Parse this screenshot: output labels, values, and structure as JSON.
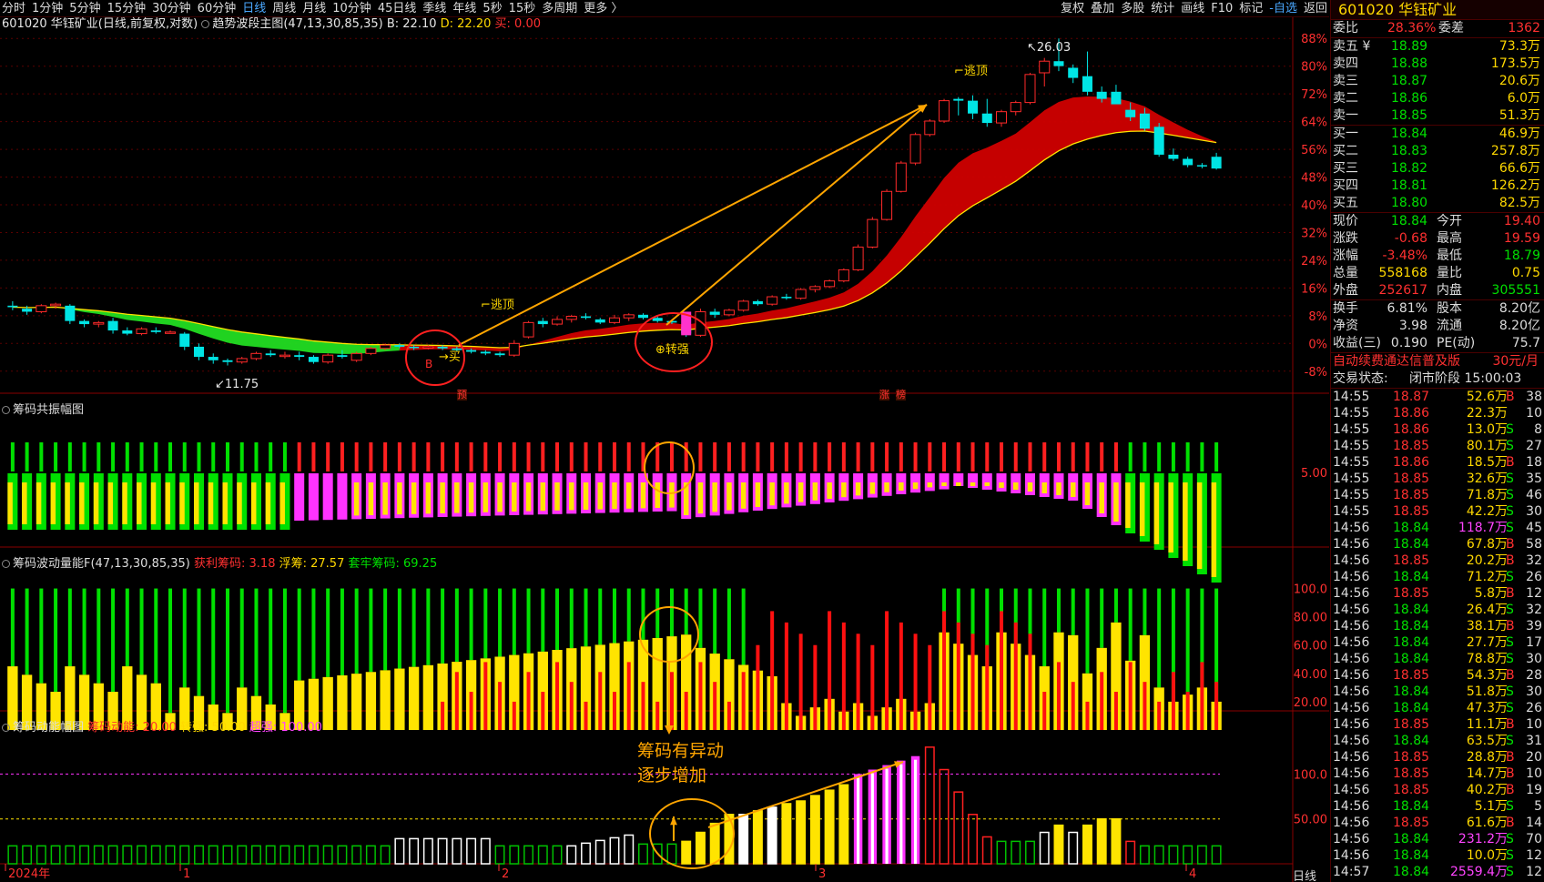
{
  "topbar": {
    "periods": [
      "分时",
      "1分钟",
      "5分钟",
      "15分钟",
      "30分钟",
      "60分钟",
      "日线",
      "周线",
      "月线",
      "10分钟",
      "45日线",
      "季线",
      "年线",
      "5秒",
      "15秒",
      "多周期",
      "更多 〉"
    ],
    "active_period": "日线",
    "tools": [
      "复权",
      "叠加",
      "多股",
      "统计",
      "画线",
      "F10",
      "标记",
      "-自选",
      "返回"
    ]
  },
  "main_panel": {
    "title": "601020 华钰矿业(日线,前复权,对数)",
    "indicator": "趋势波段主图(47,13,30,85,35)",
    "b_value": "B: 22.10",
    "d_value": "D: 22.20",
    "buy_value": "买: 0.00",
    "y_axis": [
      "88%",
      "80%",
      "72%",
      "64%",
      "56%",
      "48%",
      "40%",
      "32%",
      "24%",
      "16%",
      "8%",
      "0%",
      "-8%"
    ],
    "annotations": {
      "high": "26.03",
      "low": "11.75",
      "escape_top": "逃顶",
      "strong": "转强",
      "buy": "买",
      "b_mark": "B",
      "pre": "预",
      "rise": "涨",
      "list": "榜"
    }
  },
  "panel2": {
    "title": "筹码共振幅图",
    "y_axis": [
      "5.00"
    ]
  },
  "panel3": {
    "title": "筹码波动量能F(47,13,30,85,35)",
    "profit_label": "获利筹码: 3.18",
    "float_label": "浮筹: 27.57",
    "locked_label": "套牢筹码: 69.25",
    "y_axis": [
      "100.0",
      "80.00",
      "60.00",
      "40.00",
      "20.00"
    ]
  },
  "panel4": {
    "title": "筹码动能幅图",
    "momentum_label": "筹码动能: 20.00",
    "strong_label": "转强: 50.00",
    "super_label": "超强: 100.00",
    "y_axis": [
      "100.0",
      "50.00"
    ],
    "annotation_line1": "筹码有异动",
    "annotation_line2": "逐步增加"
  },
  "x_axis": {
    "labels": [
      "2024年",
      "1",
      "2",
      "3",
      "4"
    ],
    "period_label": "日线"
  },
  "colors": {
    "up": "#ff2a2a",
    "down": "#00e5e5",
    "bull": "#d00000",
    "bear": "#22dd22",
    "yellow": "#ffe400",
    "magenta": "#ff33ff",
    "annotation": "#ffa500"
  },
  "quote": {
    "code": "601020",
    "name": "华钰矿业",
    "weibi_label": "委比",
    "weibi": "28.36%",
    "weicha_label": "委差",
    "weicha": "1362",
    "sell": [
      {
        "label": "卖五 ¥",
        "price": "18.89",
        "vol": "73.3万"
      },
      {
        "label": "卖四",
        "price": "18.88",
        "vol": "173.5万"
      },
      {
        "label": "卖三",
        "price": "18.87",
        "vol": "20.6万"
      },
      {
        "label": "卖二",
        "price": "18.86",
        "vol": "6.0万"
      },
      {
        "label": "卖一",
        "price": "18.85",
        "vol": "51.3万"
      }
    ],
    "buy": [
      {
        "label": "买一",
        "price": "18.84",
        "vol": "46.9万"
      },
      {
        "label": "买二",
        "price": "18.83",
        "vol": "257.8万"
      },
      {
        "label": "买三",
        "price": "18.82",
        "vol": "66.6万"
      },
      {
        "label": "买四",
        "price": "18.81",
        "vol": "126.2万"
      },
      {
        "label": "买五",
        "price": "18.80",
        "vol": "82.5万"
      }
    ],
    "stats": [
      {
        "l1": "现价",
        "v1": "18.84",
        "l2": "今开",
        "v2": "19.40"
      },
      {
        "l1": "涨跌",
        "v1": "-0.68",
        "l2": "最高",
        "v2": "19.59"
      },
      {
        "l1": "涨幅",
        "v1": "-3.48%",
        "l2": "最低",
        "v2": "18.79"
      },
      {
        "l1": "总量",
        "v1": "558168",
        "l2": "量比",
        "v2": "0.75"
      },
      {
        "l1": "外盘",
        "v1": "252617",
        "l2": "内盘",
        "v2": "305551"
      }
    ],
    "fund": [
      {
        "l1": "换手",
        "v1": "6.81%",
        "l2": "股本",
        "v2": "8.20亿"
      },
      {
        "l1": "净资",
        "v1": "3.98",
        "l2": "流通",
        "v2": "8.20亿"
      },
      {
        "l1": "收益(三)",
        "v1": "0.190",
        "l2": "PE(动)",
        "v2": "75.7"
      }
    ],
    "promo": "自动续费通达信普及版",
    "promo_price": "30元/月",
    "status_label": "交易状态:",
    "status": "闭市阶段 15:00:03"
  },
  "ticks": [
    {
      "t": "14:55",
      "p": "18.87",
      "v": "52.6万",
      "s": "B",
      "n": "38"
    },
    {
      "t": "14:55",
      "p": "18.86",
      "v": "22.3万",
      "s": "",
      "n": "10"
    },
    {
      "t": "14:55",
      "p": "18.86",
      "v": "13.0万",
      "s": "S",
      "n": "8"
    },
    {
      "t": "14:55",
      "p": "18.85",
      "v": "80.1万",
      "s": "S",
      "n": "27"
    },
    {
      "t": "14:55",
      "p": "18.86",
      "v": "18.5万",
      "s": "B",
      "n": "18"
    },
    {
      "t": "14:55",
      "p": "18.85",
      "v": "32.6万",
      "s": "S",
      "n": "35"
    },
    {
      "t": "14:55",
      "p": "18.85",
      "v": "71.8万",
      "s": "S",
      "n": "46"
    },
    {
      "t": "14:55",
      "p": "18.85",
      "v": "42.2万",
      "s": "S",
      "n": "30"
    },
    {
      "t": "14:56",
      "p": "18.84",
      "v": "118.7万",
      "s": "S",
      "n": "45"
    },
    {
      "t": "14:56",
      "p": "18.84",
      "v": "67.8万",
      "s": "B",
      "n": "58"
    },
    {
      "t": "14:56",
      "p": "18.85",
      "v": "20.2万",
      "s": "B",
      "n": "32"
    },
    {
      "t": "14:56",
      "p": "18.84",
      "v": "71.2万",
      "s": "S",
      "n": "26"
    },
    {
      "t": "14:56",
      "p": "18.85",
      "v": "5.8万",
      "s": "B",
      "n": "12"
    },
    {
      "t": "14:56",
      "p": "18.84",
      "v": "26.4万",
      "s": "S",
      "n": "32"
    },
    {
      "t": "14:56",
      "p": "18.84",
      "v": "38.1万",
      "s": "B",
      "n": "39"
    },
    {
      "t": "14:56",
      "p": "18.84",
      "v": "27.7万",
      "s": "S",
      "n": "17"
    },
    {
      "t": "14:56",
      "p": "18.84",
      "v": "78.8万",
      "s": "S",
      "n": "30"
    },
    {
      "t": "14:56",
      "p": "18.85",
      "v": "54.3万",
      "s": "B",
      "n": "28"
    },
    {
      "t": "14:56",
      "p": "18.84",
      "v": "51.8万",
      "s": "S",
      "n": "30"
    },
    {
      "t": "14:56",
      "p": "18.84",
      "v": "47.3万",
      "s": "S",
      "n": "26"
    },
    {
      "t": "14:56",
      "p": "18.85",
      "v": "11.1万",
      "s": "B",
      "n": "10"
    },
    {
      "t": "14:56",
      "p": "18.84",
      "v": "63.5万",
      "s": "S",
      "n": "31"
    },
    {
      "t": "14:56",
      "p": "18.85",
      "v": "28.8万",
      "s": "B",
      "n": "20"
    },
    {
      "t": "14:56",
      "p": "18.85",
      "v": "14.7万",
      "s": "B",
      "n": "10"
    },
    {
      "t": "14:56",
      "p": "18.85",
      "v": "40.2万",
      "s": "B",
      "n": "19"
    },
    {
      "t": "14:56",
      "p": "18.84",
      "v": "5.1万",
      "s": "S",
      "n": "5"
    },
    {
      "t": "14:56",
      "p": "18.85",
      "v": "61.6万",
      "s": "B",
      "n": "14"
    },
    {
      "t": "14:56",
      "p": "18.84",
      "v": "231.2万",
      "s": "S",
      "n": "70"
    },
    {
      "t": "14:56",
      "p": "18.84",
      "v": "10.0万",
      "s": "S",
      "n": "12"
    },
    {
      "t": "14:57",
      "p": "18.84",
      "v": "2559.4万",
      "s": "S",
      "n": "12"
    }
  ],
  "chart_data": {
    "type": "candlestick",
    "candles": [
      [
        13.4,
        13.55,
        13.25,
        13.35
      ],
      [
        13.3,
        13.4,
        13.1,
        13.2
      ],
      [
        13.2,
        13.45,
        13.15,
        13.4
      ],
      [
        13.4,
        13.5,
        13.3,
        13.45
      ],
      [
        13.4,
        13.45,
        12.8,
        12.9
      ],
      [
        12.9,
        12.95,
        12.7,
        12.8
      ],
      [
        12.8,
        12.9,
        12.7,
        12.85
      ],
      [
        12.9,
        13.0,
        12.5,
        12.6
      ],
      [
        12.6,
        12.7,
        12.45,
        12.5
      ],
      [
        12.5,
        12.7,
        12.45,
        12.65
      ],
      [
        12.6,
        12.7,
        12.5,
        12.55
      ],
      [
        12.55,
        12.6,
        12.5,
        12.55
      ],
      [
        12.5,
        12.55,
        12.0,
        12.1
      ],
      [
        12.1,
        12.2,
        11.7,
        11.8
      ],
      [
        11.8,
        11.9,
        11.6,
        11.7
      ],
      [
        11.7,
        11.75,
        11.55,
        11.65
      ],
      [
        11.65,
        11.8,
        11.6,
        11.75
      ],
      [
        11.75,
        11.95,
        11.7,
        11.9
      ],
      [
        11.9,
        12.0,
        11.8,
        11.85
      ],
      [
        11.85,
        11.95,
        11.75,
        11.85
      ],
      [
        11.85,
        11.95,
        11.7,
        11.8
      ],
      [
        11.8,
        11.85,
        11.6,
        11.65
      ],
      [
        11.65,
        11.9,
        11.6,
        11.85
      ],
      [
        11.85,
        12.0,
        11.75,
        11.8
      ],
      [
        11.7,
        11.95,
        11.65,
        11.9
      ],
      [
        11.9,
        12.1,
        11.85,
        12.05
      ],
      [
        12.05,
        12.2,
        12.0,
        12.15
      ],
      [
        12.15,
        12.2,
        12.05,
        12.1
      ],
      [
        12.1,
        12.15,
        12.0,
        12.08
      ],
      [
        12.08,
        12.15,
        12.02,
        12.1
      ],
      [
        12.1,
        12.15,
        12.0,
        12.05
      ],
      [
        12.05,
        12.1,
        11.95,
        12.0
      ],
      [
        12.0,
        12.05,
        11.9,
        11.95
      ],
      [
        11.95,
        12.0,
        11.85,
        11.9
      ],
      [
        11.9,
        11.95,
        11.8,
        11.85
      ],
      [
        11.85,
        12.3,
        11.8,
        12.2
      ],
      [
        12.4,
        12.9,
        12.35,
        12.85
      ],
      [
        12.9,
        13.0,
        12.7,
        12.8
      ],
      [
        12.8,
        13.05,
        12.75,
        12.95
      ],
      [
        12.95,
        13.1,
        12.85,
        13.05
      ],
      [
        13.05,
        13.15,
        12.95,
        13.0
      ],
      [
        12.95,
        13.0,
        12.8,
        12.85
      ],
      [
        12.85,
        13.1,
        12.8,
        13.0
      ],
      [
        13.0,
        13.15,
        12.9,
        13.1
      ],
      [
        13.1,
        13.15,
        12.95,
        13.0
      ],
      [
        13.0,
        13.05,
        12.85,
        12.9
      ],
      [
        12.9,
        12.95,
        12.8,
        12.85
      ],
      [
        12.7,
        12.8,
        12.4,
        12.5
      ],
      [
        12.45,
        13.3,
        12.4,
        13.2
      ],
      [
        13.2,
        13.3,
        13.0,
        13.1
      ],
      [
        13.1,
        13.3,
        13.05,
        13.25
      ],
      [
        13.25,
        13.6,
        13.2,
        13.55
      ],
      [
        13.55,
        13.6,
        13.4,
        13.45
      ],
      [
        13.45,
        13.75,
        13.4,
        13.7
      ],
      [
        13.7,
        13.8,
        13.6,
        13.65
      ],
      [
        13.65,
        14.0,
        13.6,
        13.95
      ],
      [
        13.95,
        14.1,
        13.85,
        14.05
      ],
      [
        14.05,
        14.3,
        14.0,
        14.25
      ],
      [
        14.25,
        14.7,
        14.2,
        14.65
      ],
      [
        14.65,
        15.6,
        14.6,
        15.5
      ],
      [
        15.5,
        16.7,
        15.45,
        16.6
      ],
      [
        16.6,
        17.9,
        16.55,
        17.8
      ],
      [
        17.8,
        19.2,
        17.75,
        19.1
      ],
      [
        19.1,
        20.6,
        19.0,
        20.5
      ],
      [
        20.5,
        21.3,
        20.4,
        21.2
      ],
      [
        21.2,
        22.4,
        21.1,
        22.3
      ],
      [
        22.4,
        22.5,
        21.5,
        22.3
      ],
      [
        22.3,
        22.6,
        21.3,
        21.6
      ],
      [
        21.6,
        22.4,
        20.9,
        21.1
      ],
      [
        21.1,
        21.8,
        20.9,
        21.7
      ],
      [
        21.7,
        22.3,
        21.5,
        22.2
      ],
      [
        22.2,
        23.9,
        22.1,
        23.8
      ],
      [
        23.9,
        24.8,
        23.1,
        24.6
      ],
      [
        24.6,
        26.03,
        24.0,
        24.3
      ],
      [
        24.2,
        24.4,
        23.3,
        23.6
      ],
      [
        23.7,
        25.2,
        22.6,
        22.8
      ],
      [
        22.8,
        23.1,
        22.2,
        22.4
      ],
      [
        22.8,
        23.2,
        22.5,
        22.1
      ],
      [
        21.8,
        22.2,
        21.2,
        21.4
      ],
      [
        21.6,
        21.9,
        20.7,
        20.8
      ],
      [
        20.9,
        21.1,
        19.4,
        19.5
      ],
      [
        19.5,
        19.8,
        19.2,
        19.3
      ],
      [
        19.3,
        19.4,
        18.9,
        19.0
      ],
      [
        19.0,
        19.1,
        18.85,
        18.95
      ],
      [
        19.4,
        19.59,
        18.79,
        18.84
      ]
    ],
    "y_axis_pct": [
      88,
      80,
      72,
      64,
      56,
      48,
      40,
      32,
      24,
      16,
      8,
      0,
      -8
    ],
    "high_label": 26.03,
    "low_label": 11.75,
    "x_labels": [
      "2024年",
      "1",
      "2",
      "3",
      "4"
    ]
  }
}
